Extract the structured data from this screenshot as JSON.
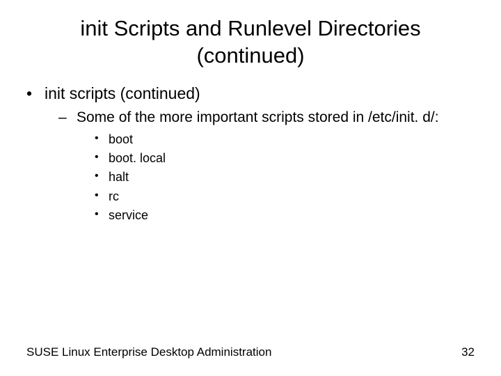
{
  "title_line1": "init Scripts and Runlevel Directories",
  "title_line2": "(continued)",
  "bullets": {
    "l1": "init scripts (continued)",
    "l2": "Some of the more important scripts stored in /etc/init. d/:",
    "l3": [
      "boot",
      "boot. local",
      "halt",
      "rc",
      "service"
    ]
  },
  "footer": {
    "left": "SUSE Linux Enterprise Desktop Administration",
    "right": "32"
  }
}
